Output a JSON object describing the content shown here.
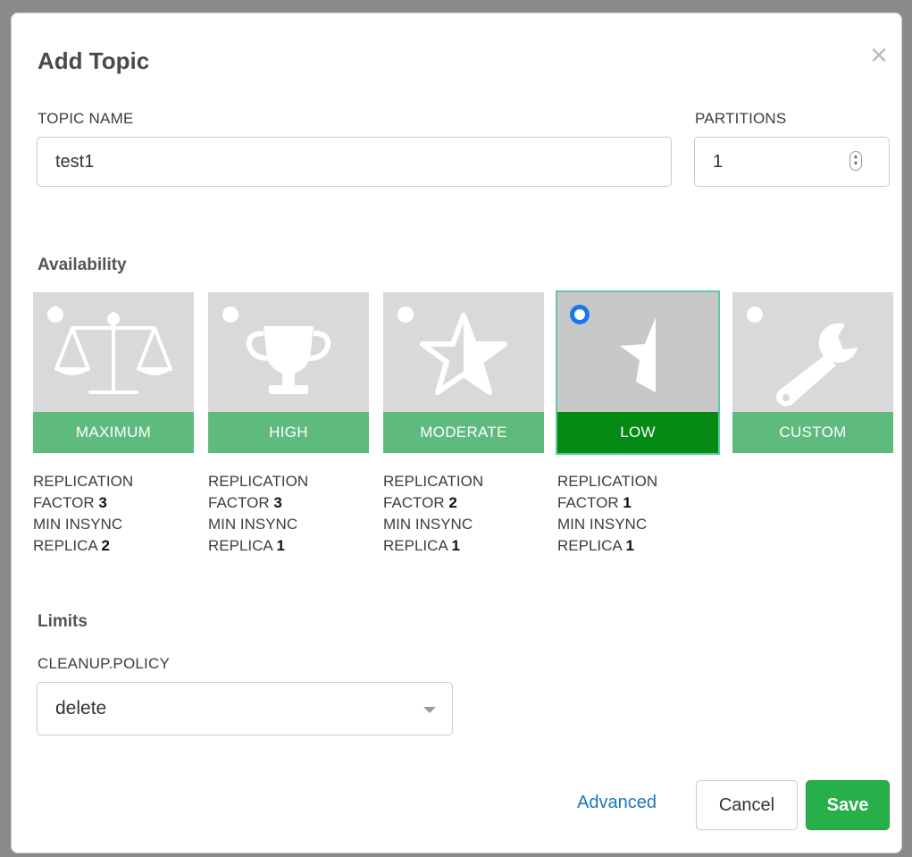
{
  "dialog": {
    "title": "Add Topic",
    "close_glyph": "✕"
  },
  "topic": {
    "name_label": "TOPIC NAME",
    "name_value": "test1",
    "partitions_label": "PARTITIONS",
    "partitions_value": "1"
  },
  "availability": {
    "heading": "Availability",
    "selected": "LOW",
    "options": [
      {
        "label": "MAXIMUM",
        "icon": "scale-icon",
        "replication_label": "REPLICATION",
        "factor_label": "FACTOR",
        "factor_value": "3",
        "insync_label": "MIN INSYNC",
        "replica_label": "REPLICA",
        "replica_value": "2"
      },
      {
        "label": "HIGH",
        "icon": "trophy-icon",
        "replication_label": "REPLICATION",
        "factor_label": "FACTOR",
        "factor_value": "3",
        "insync_label": "MIN INSYNC",
        "replica_label": "REPLICA",
        "replica_value": "1"
      },
      {
        "label": "MODERATE",
        "icon": "half-star-icon",
        "replication_label": "REPLICATION",
        "factor_label": "FACTOR",
        "factor_value": "2",
        "insync_label": "MIN INSYNC",
        "replica_label": "REPLICA",
        "replica_value": "1"
      },
      {
        "label": "LOW",
        "icon": "star-sliver-icon",
        "replication_label": "REPLICATION",
        "factor_label": "FACTOR",
        "factor_value": "1",
        "insync_label": "MIN INSYNC",
        "replica_label": "REPLICA",
        "replica_value": "1"
      },
      {
        "label": "CUSTOM",
        "icon": "wrench-icon"
      }
    ]
  },
  "limits": {
    "heading": "Limits",
    "cleanup_label": "CLEANUP.POLICY",
    "cleanup_value": "delete"
  },
  "footer": {
    "advanced_label": "Advanced",
    "cancel_label": "Cancel",
    "save_label": "Save"
  },
  "colors": {
    "tile": "#d9d9d9",
    "bar": "#5fba7d",
    "bar_selected": "#058a14",
    "radio_selected": "#1677f5",
    "save": "#27b04a",
    "link": "#1a78b8"
  }
}
